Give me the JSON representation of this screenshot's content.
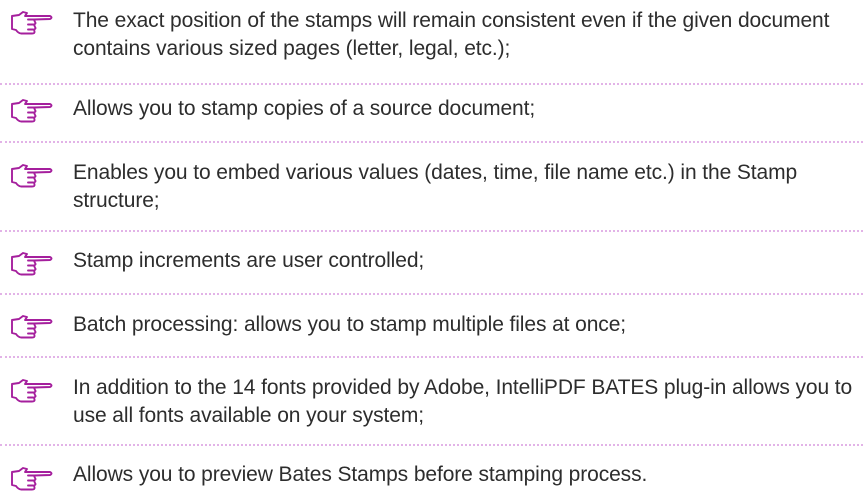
{
  "colors": {
    "icon": "#a51f9d",
    "separator": "#e2b3e7",
    "text": "#2d2d2d"
  },
  "icon_name": "pointing-hand-icon",
  "features": [
    {
      "text": "The exact position of the stamps will remain consistent even if the given document contains various sized pages (letter, legal, etc.);"
    },
    {
      "text": "Allows you to stamp copies of a source document;"
    },
    {
      "text": "Enables you to embed various values (dates, time, file name etc.) in the Stamp structure;"
    },
    {
      "text": "Stamp increments are user controlled;"
    },
    {
      "text": "Batch processing: allows you to stamp multiple files at once;"
    },
    {
      "text": "In addition to the 14 fonts provided by Adobe, IntelliPDF BATES plug-in allows you to use all fonts available on your system;"
    },
    {
      "text": "Allows you to preview Bates Stamps before stamping process."
    }
  ]
}
